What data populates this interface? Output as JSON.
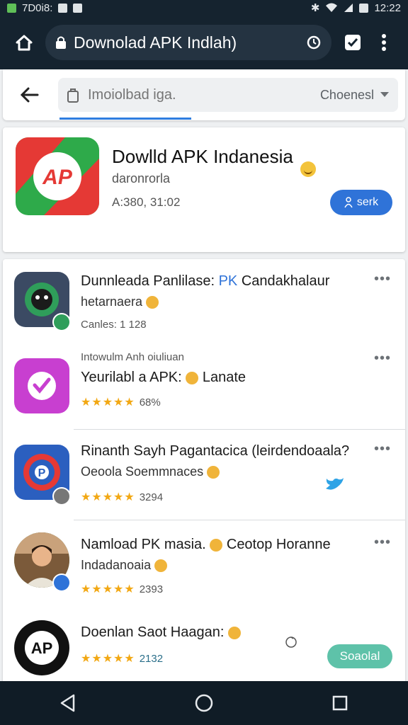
{
  "status_bar": {
    "left_text": "7D0i8:",
    "time": "12:22"
  },
  "browser": {
    "url_title": "Downolad APK Indlah)"
  },
  "search": {
    "placeholder": "Imoiolbad iga.",
    "select_value": "Choenesl"
  },
  "featured_app": {
    "title": "Dowlld APK Indanesia",
    "subtitle": "daronrorla",
    "meta": "A:380, 31:02",
    "button_label": "serk"
  },
  "list_items": [
    {
      "title": "Dunnleada Panlilase: ",
      "title_tag": "PK",
      "title_suffix": " Candakhalaur",
      "subtitle": "hetarnaera",
      "meta": "Canles: 1 128",
      "icon_color": "#3b4a63"
    },
    {
      "pre_title": "Intowulm Anh oiuliuan",
      "title": "Yeurilabl a APK:",
      "title_suffix": " Lanate",
      "meta": "68%",
      "icon_color": "#c83fd0"
    },
    {
      "title": "Rinanth Sayh Pagantacica (leirdendoaala?",
      "subtitle": "Oeoola Soemmnaces",
      "meta": "3294",
      "icon_color": "#2b5fbf"
    },
    {
      "title": "Namload PK masia.",
      "title_suffix": " Ceotop Horanne",
      "subtitle": "Indadanoaia",
      "meta": "2393",
      "icon_color": "#6aa84f"
    },
    {
      "title": "Doenlan Saot Haagan:",
      "meta": "2132",
      "button_label": "Soaolal",
      "icon_color": "#111111"
    }
  ],
  "colors": {
    "toolbar": "#15232f",
    "accent_blue": "#2f73d8",
    "accent_teal": "#5ec2a9",
    "star": "#f2a814"
  },
  "icons": {
    "toolbar": [
      "home-icon",
      "lock-icon",
      "clock-icon",
      "check-square-icon",
      "more-vert-icon"
    ],
    "nav": [
      "back-triangle-icon",
      "home-circle-icon",
      "recents-square-icon"
    ]
  }
}
